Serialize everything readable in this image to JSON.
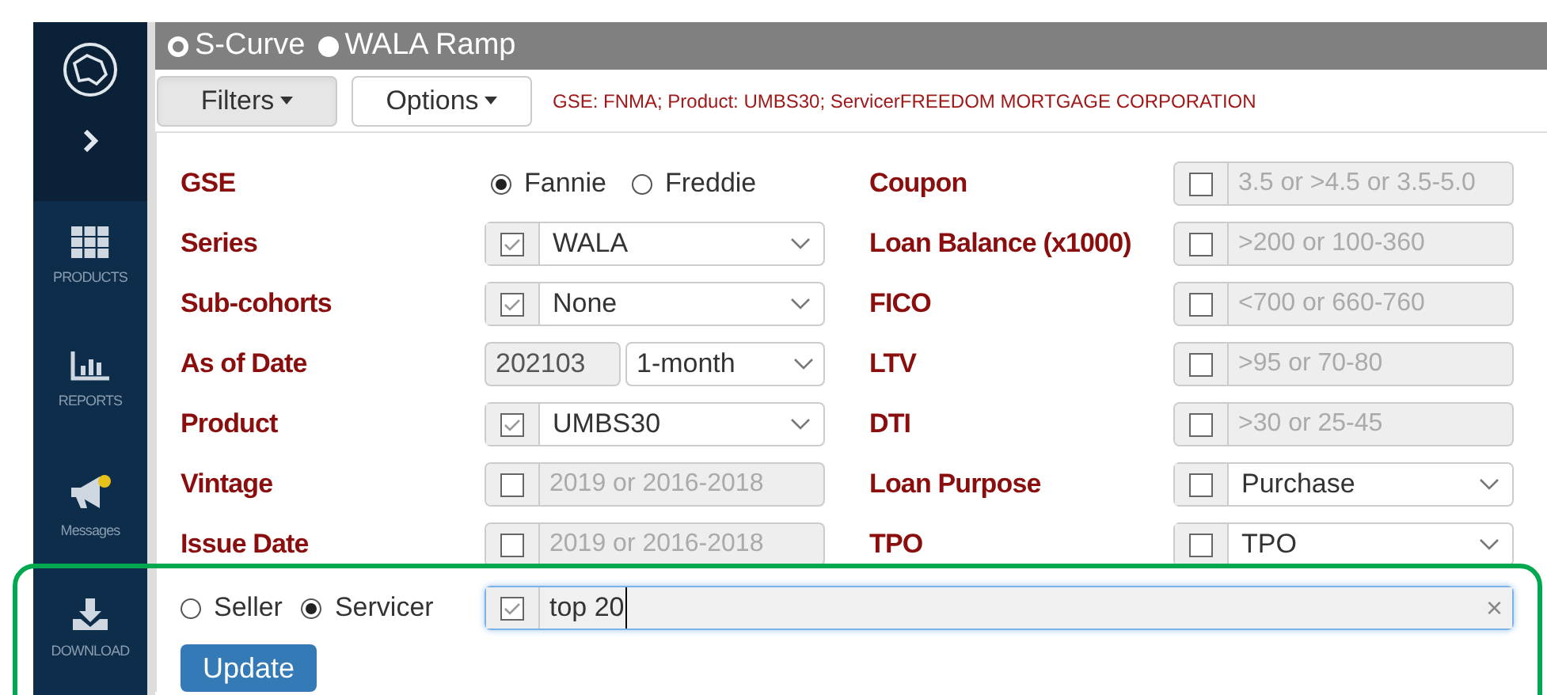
{
  "sidebar": {
    "items": [
      {
        "kind": "grid",
        "label": "PRODUCTS"
      },
      {
        "kind": "chart",
        "label": "REPORTS"
      },
      {
        "kind": "megaphone",
        "label": "Messages"
      },
      {
        "kind": "download",
        "label": "DOWNLOAD"
      }
    ]
  },
  "chart_modes": [
    {
      "label": "S-Curve",
      "selected": true
    },
    {
      "label": "WALA Ramp",
      "selected": false
    }
  ],
  "toolbar": {
    "buttons": [
      {
        "label": "Filters",
        "selected": true
      },
      {
        "label": "Options",
        "selected": false
      }
    ],
    "summary": "GSE: FNMA; Product: UMBS30; ServicerFREEDOM MORTGAGE CORPORATION"
  },
  "filters": [
    {
      "label": "GSE",
      "kind": "radio",
      "options": [
        {
          "label": "Fannie",
          "selected": true
        },
        {
          "label": "Freddie",
          "selected": false
        }
      ]
    },
    {
      "label": "Coupon",
      "kind": "text",
      "checked": false,
      "placeholder": "3.5 or >4.5 or 3.5-5.0"
    },
    {
      "label": "Series",
      "kind": "select",
      "checked": true,
      "value": "WALA"
    },
    {
      "label": "Loan Balance (x1000)",
      "kind": "text",
      "checked": false,
      "placeholder": ">200 or 100-360"
    },
    {
      "label": "Sub-cohorts",
      "kind": "select",
      "checked": true,
      "value": "None"
    },
    {
      "label": "FICO",
      "kind": "text",
      "checked": false,
      "placeholder": "<700 or 660-760"
    },
    {
      "label": "As of Date",
      "kind": "date",
      "value": "202103",
      "period": "1-month"
    },
    {
      "label": "LTV",
      "kind": "text",
      "checked": false,
      "placeholder": ">95 or 70-80"
    },
    {
      "label": "Product",
      "kind": "select",
      "checked": true,
      "value": "UMBS30"
    },
    {
      "label": "DTI",
      "kind": "text",
      "checked": false,
      "placeholder": ">30 or 25-45"
    },
    {
      "label": "Vintage",
      "kind": "text",
      "checked": false,
      "placeholder": "2019 or 2016-2018"
    },
    {
      "label": "Loan Purpose",
      "kind": "select",
      "checked": false,
      "value": "Purchase"
    },
    {
      "label": "Issue Date",
      "kind": "text",
      "checked": false,
      "placeholder": "2019 or 2016-2018"
    },
    {
      "label": "TPO",
      "kind": "select",
      "checked": false,
      "value": "TPO"
    }
  ],
  "entity": {
    "options": [
      {
        "label": "Seller",
        "selected": false
      },
      {
        "label": "Servicer",
        "selected": true
      }
    ],
    "checked": true,
    "value": "top 20",
    "clear": "×"
  },
  "update_button": "Update"
}
